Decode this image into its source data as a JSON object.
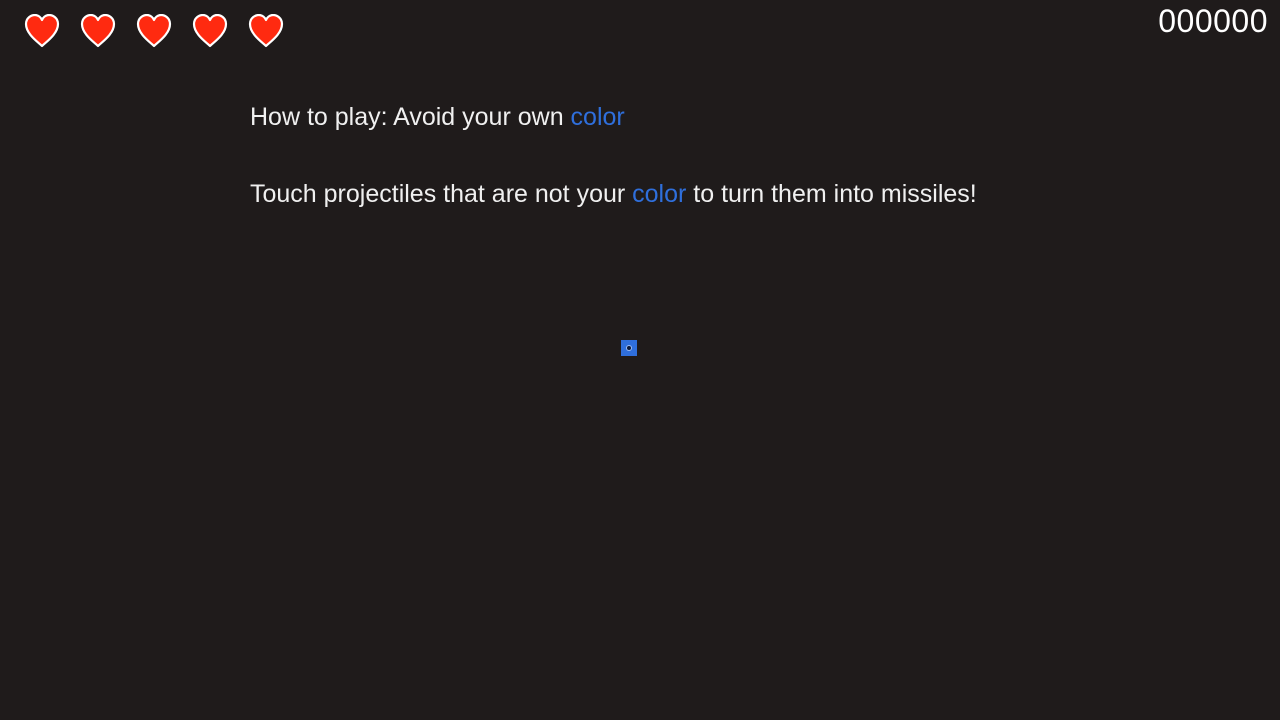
{
  "hud": {
    "lives": [
      {
        "icon": "heart-icon"
      },
      {
        "icon": "heart-icon"
      },
      {
        "icon": "heart-icon"
      },
      {
        "icon": "heart-icon"
      },
      {
        "icon": "heart-icon"
      }
    ],
    "score": "000000"
  },
  "instructions": {
    "line1": {
      "before": "How to play: Avoid your own ",
      "highlight": "color",
      "after": ""
    },
    "line2": {
      "before": "Touch projectiles that are not your ",
      "highlight": "color",
      "after": " to turn them into missiles!"
    }
  },
  "player": {
    "color": "#2f6fdc"
  },
  "colors": {
    "background": "#1f1b1b",
    "heart": "#ff2a10",
    "heart_outline": "#ffffff",
    "accent": "#2f6fdc"
  }
}
